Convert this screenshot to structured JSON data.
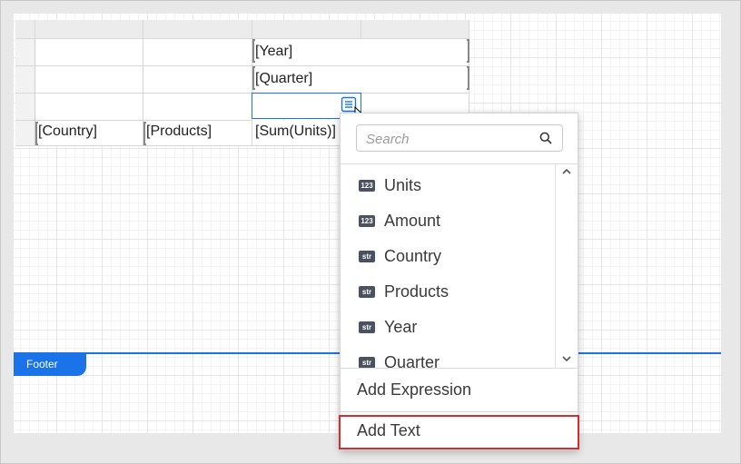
{
  "table": {
    "year_cell": "[Year]",
    "quarter_cell": "[Quarter]",
    "country_cell": "[Country]",
    "products_cell": "[Products]",
    "sum_cell": "[Sum(Units)]"
  },
  "band": {
    "footer_label": "Footer"
  },
  "popup": {
    "search_placeholder": "Search",
    "fields": [
      {
        "type": "123",
        "name": "Units"
      },
      {
        "type": "123",
        "name": "Amount"
      },
      {
        "type": "str",
        "name": "Country"
      },
      {
        "type": "str",
        "name": "Products"
      },
      {
        "type": "str",
        "name": "Year"
      },
      {
        "type": "str",
        "name": "Quarter"
      }
    ],
    "add_expression": "Add Expression",
    "add_text": "Add Text"
  },
  "colors": {
    "accent": "#1a73e8",
    "highlight": "#d32f2f",
    "badge": "#4a5160"
  },
  "icons": {
    "search": "search-icon",
    "field_list": "field-list-icon",
    "scroll_up": "chevron-up-icon",
    "scroll_down": "chevron-down-icon"
  }
}
